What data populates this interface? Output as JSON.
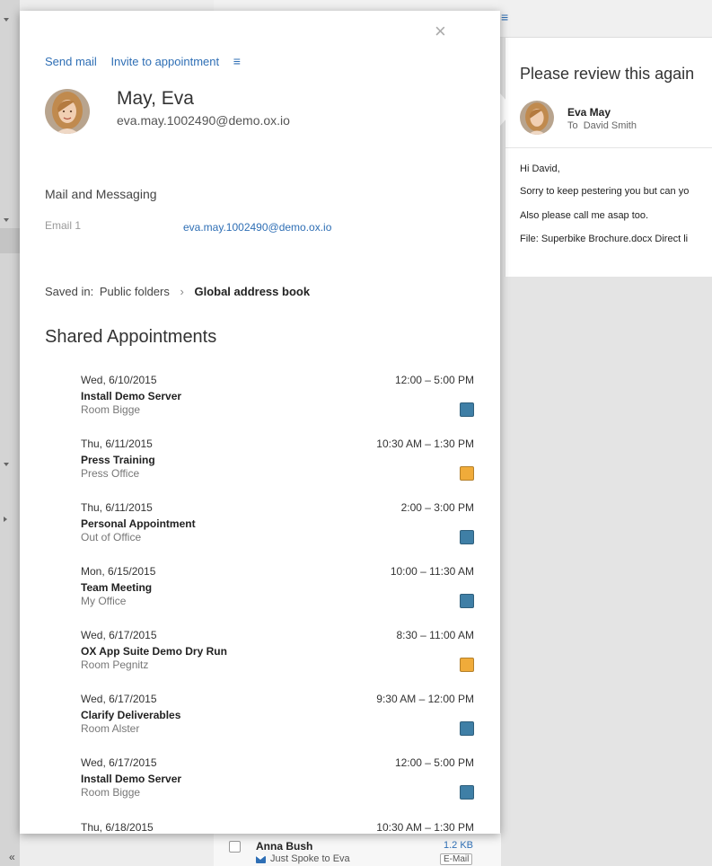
{
  "background": {
    "list_menu_icon": "hamburger-menu-icon",
    "collapse_icon_glyph": "«"
  },
  "mail_detail": {
    "subject": "Please review this again",
    "from_name": "Eva May",
    "to_label": "To",
    "to_name": "David Smith",
    "body_lines": [
      "Hi David,",
      "Sorry to keep pestering you but can yo",
      "Also please call me asap too.",
      "File: Superbike Brochure.docx Direct li"
    ]
  },
  "mail_list_row": {
    "sender": "Anna Bush",
    "size": "1.2 KB",
    "subject": "Just Spoke to Eva",
    "badge": "E-Mail"
  },
  "halo": {
    "close_glyph": "×",
    "actions": {
      "send_mail": "Send mail",
      "invite": "Invite to appointment",
      "more_glyph": "≡"
    },
    "contact": {
      "name": "May, Eva",
      "email": "eva.may.1002490@demo.ox.io"
    },
    "mail_section": {
      "title": "Mail and Messaging",
      "email_label": "Email 1",
      "email_value": "eva.may.1002490@demo.ox.io"
    },
    "saved_in": {
      "label": "Saved in:",
      "folder": "Public folders",
      "separator": "›",
      "book": "Global address book"
    },
    "shared_title": "Shared Appointments",
    "colors": {
      "blue": "#3f7fa6",
      "orange": "#f0ab3a"
    },
    "appointments": [
      {
        "date": "Wed, 6/10/2015",
        "time": "12:00 – 5:00 PM",
        "title": "Install Demo Server",
        "location": "Room Bigge",
        "color": "#3f7fa6"
      },
      {
        "date": "Thu, 6/11/2015",
        "time": "10:30 AM – 1:30 PM",
        "title": "Press Training",
        "location": "Press Office",
        "color": "#f0ab3a"
      },
      {
        "date": "Thu, 6/11/2015",
        "time": "2:00 – 3:00 PM",
        "title": "Personal Appointment",
        "location": "Out of Office",
        "color": "#3f7fa6"
      },
      {
        "date": "Mon, 6/15/2015",
        "time": "10:00 – 11:30 AM",
        "title": "Team Meeting",
        "location": "My Office",
        "color": "#3f7fa6"
      },
      {
        "date": "Wed, 6/17/2015",
        "time": "8:30 – 11:00 AM",
        "title": "OX App Suite Demo Dry Run",
        "location": "Room Pegnitz",
        "color": "#f0ab3a"
      },
      {
        "date": "Wed, 6/17/2015",
        "time": "9:30 AM – 12:00 PM",
        "title": "Clarify Deliverables",
        "location": "Room Alster",
        "color": "#3f7fa6"
      },
      {
        "date": "Wed, 6/17/2015",
        "time": "12:00 – 5:00 PM",
        "title": "Install Demo Server",
        "location": "Room Bigge",
        "color": "#3f7fa6"
      },
      {
        "date": "Thu, 6/18/2015",
        "time": "10:30 AM – 1:30 PM",
        "title": "",
        "location": "",
        "color": ""
      }
    ]
  }
}
